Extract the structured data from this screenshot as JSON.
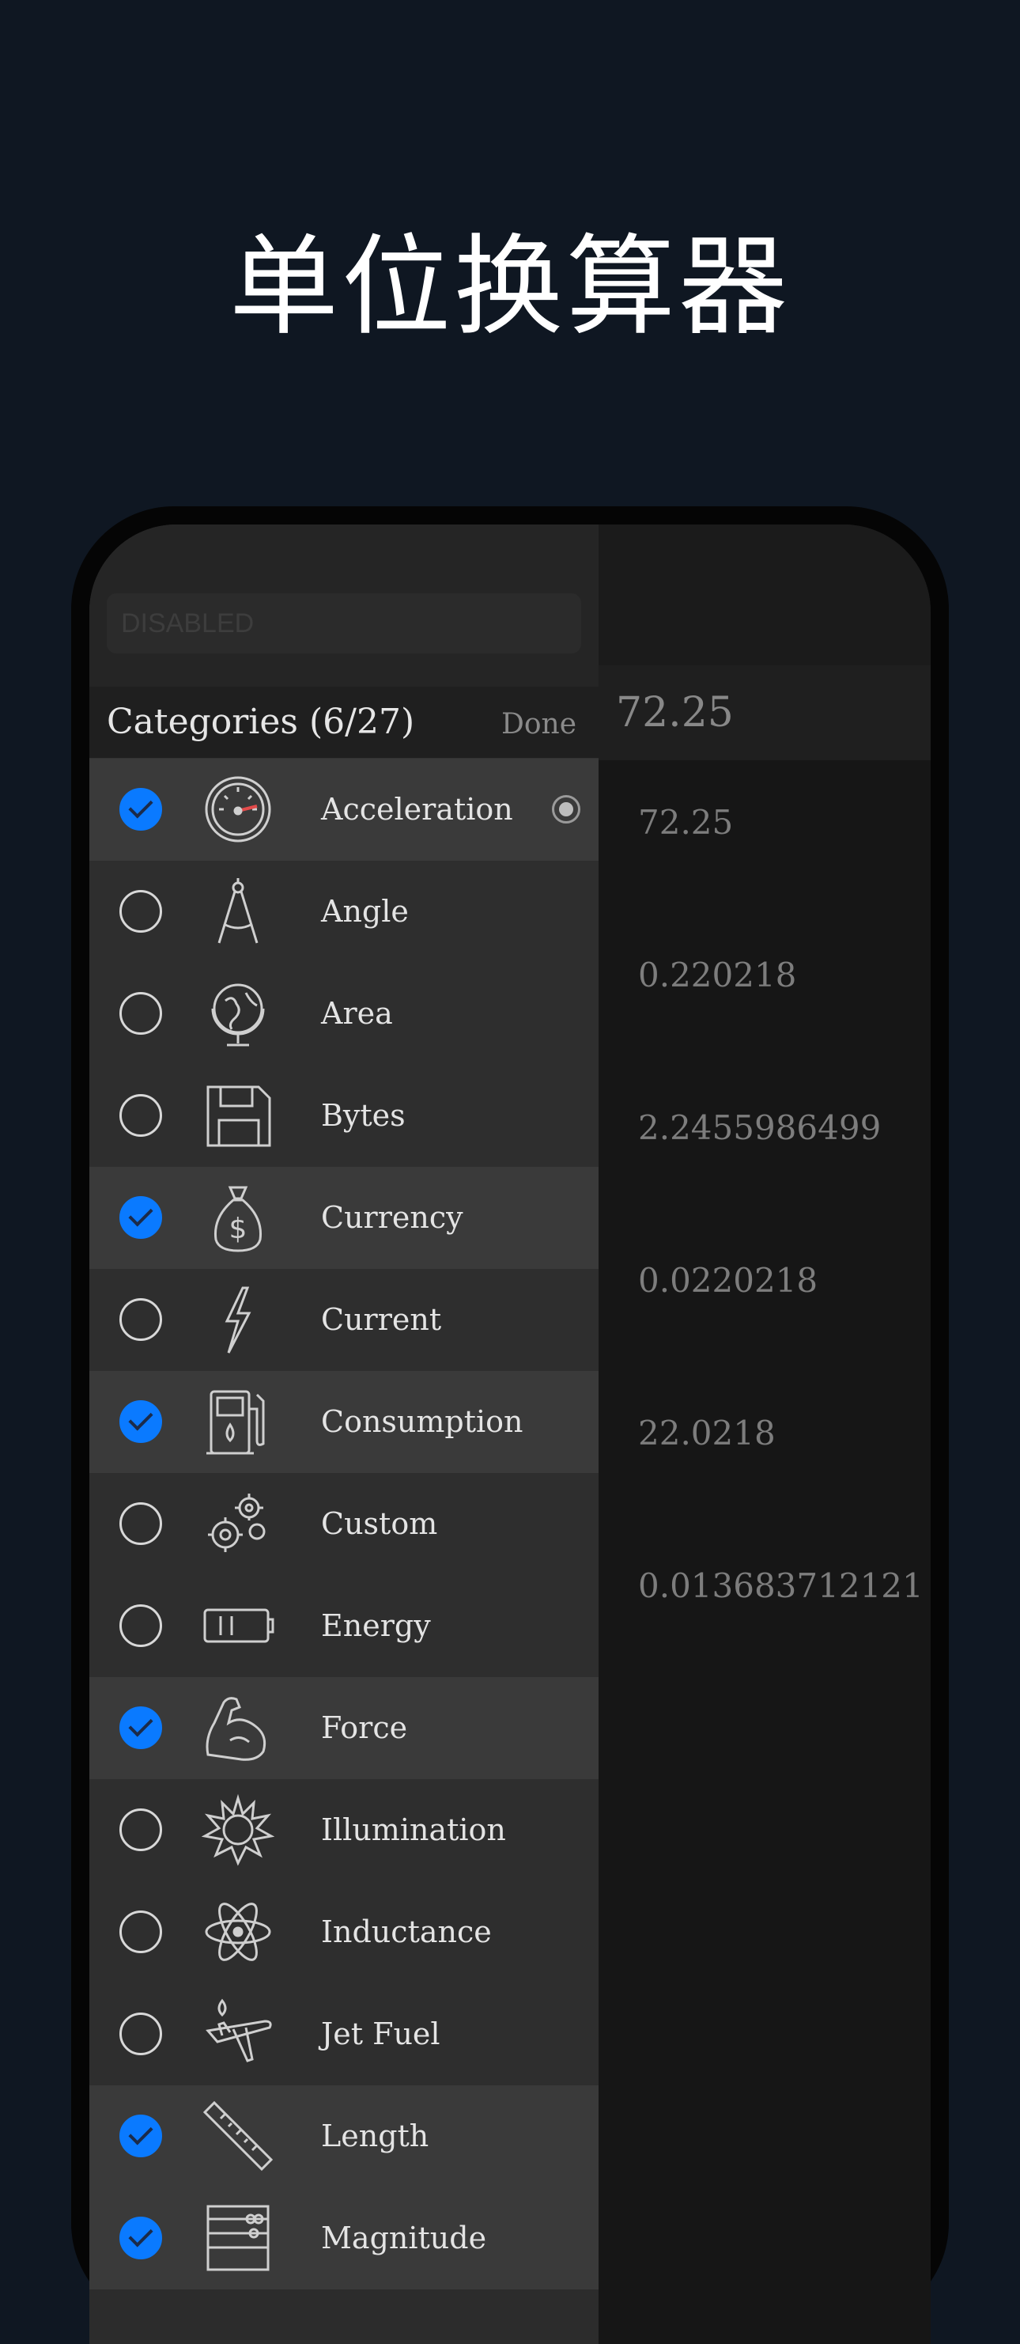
{
  "promo": {
    "title": "单位换算器"
  },
  "converter": {
    "input_value": "72.25",
    "results": [
      "72.25",
      "0.220218",
      "2.2455986499",
      "0.0220218",
      "22.0218",
      "0.013683712121"
    ]
  },
  "sidebar": {
    "disabled_text": "DISABLED",
    "header": "Categories (6/27)",
    "done_label": "Done",
    "items": [
      {
        "label": "Acceleration",
        "checked": true,
        "icon": "speedometer-icon"
      },
      {
        "label": "Angle",
        "checked": false,
        "icon": "compass-icon"
      },
      {
        "label": "Area",
        "checked": false,
        "icon": "globe-icon"
      },
      {
        "label": "Bytes",
        "checked": false,
        "icon": "floppy-disk-icon"
      },
      {
        "label": "Currency",
        "checked": true,
        "icon": "money-bag-icon"
      },
      {
        "label": "Current",
        "checked": false,
        "icon": "lightning-bolt-icon"
      },
      {
        "label": "Consumption",
        "checked": true,
        "icon": "fuel-pump-icon"
      },
      {
        "label": "Custom",
        "checked": false,
        "icon": "gears-icon"
      },
      {
        "label": "Energy",
        "checked": false,
        "icon": "battery-icon"
      },
      {
        "label": "Force",
        "checked": true,
        "icon": "flexed-arm-icon"
      },
      {
        "label": "Illumination",
        "checked": false,
        "icon": "sun-icon"
      },
      {
        "label": "Inductance",
        "checked": false,
        "icon": "atom-icon"
      },
      {
        "label": "Jet Fuel",
        "checked": false,
        "icon": "airplane-icon"
      },
      {
        "label": "Length",
        "checked": true,
        "icon": "ruler-icon"
      },
      {
        "label": "Magnitude",
        "checked": true,
        "icon": "abacus-icon"
      }
    ]
  }
}
